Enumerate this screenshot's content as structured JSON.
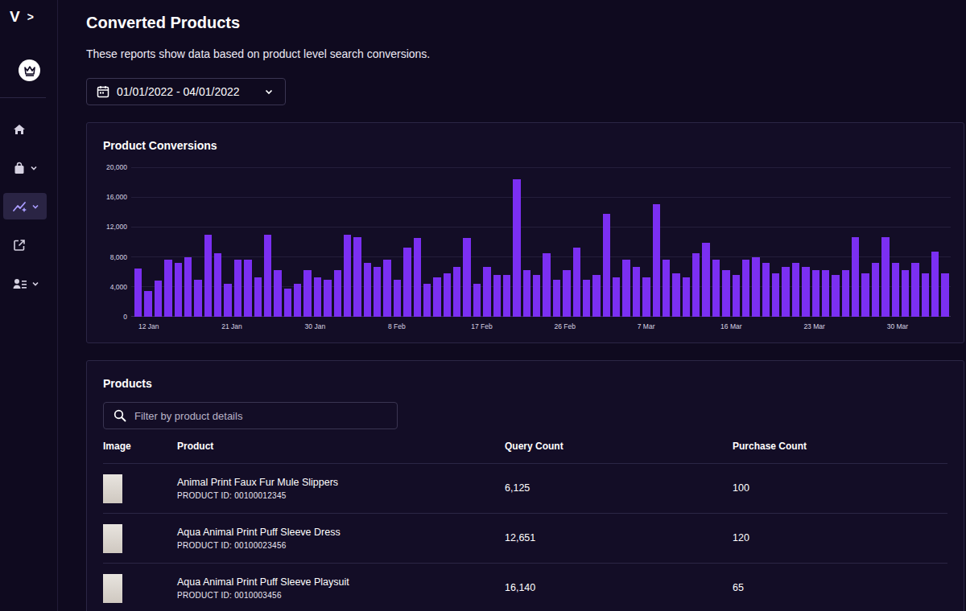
{
  "sidebar": {
    "brand": "V",
    "toggle": ">",
    "items": [
      {
        "expandable": false,
        "selected": false
      },
      {
        "expandable": true,
        "selected": false
      },
      {
        "expandable": true,
        "selected": true
      },
      {
        "expandable": false,
        "selected": false
      },
      {
        "expandable": true,
        "selected": false
      }
    ]
  },
  "page": {
    "title": "Converted Products",
    "subtitle": "These reports show data based on product level search conversions."
  },
  "date_range": {
    "label": "01/01/2022 - 04/01/2022"
  },
  "chart": {
    "title": "Product Conversions",
    "y_ticks": [
      "20,000",
      "16,000",
      "12,000",
      "8,000",
      "4,000",
      "0"
    ],
    "x_ticks": [
      "12 Jan",
      "21 Jan",
      "30 Jan",
      "8 Feb",
      "17 Feb",
      "26 Feb",
      "7 Mar",
      "16 Mar",
      "23 Mar",
      "30 Mar"
    ],
    "values": [
      6500,
      3400,
      4800,
      7600,
      7200,
      8000,
      4900,
      11000,
      8500,
      4400,
      7600,
      7600,
      5300,
      11000,
      6200,
      3800,
      4400,
      6200,
      5300,
      4900,
      6200,
      11000,
      10600,
      7200,
      6700,
      7600,
      4900,
      9200,
      10500,
      4400,
      5300,
      5800,
      6700,
      10500,
      4400,
      6700,
      5600,
      5600,
      18400,
      6200,
      5600,
      8500,
      4900,
      6200,
      9200,
      4900,
      5600,
      13800,
      5300,
      7600,
      6700,
      5300,
      15100,
      7600,
      5800,
      5300,
      8500,
      9900,
      7600,
      6200,
      5600,
      7600,
      8000,
      7200,
      5800,
      6700,
      7200,
      6700,
      6200,
      6200,
      5600,
      6200,
      10600,
      5800,
      7200,
      10600,
      7200,
      6200,
      7200,
      5800,
      8700,
      5800
    ]
  },
  "products": {
    "title": "Products",
    "search": {
      "placeholder": "Filter by product details"
    },
    "columns": [
      "Image",
      "Product",
      "Query Count",
      "Purchase Count"
    ],
    "rows": [
      {
        "name": "Animal Print Faux Fur Mule Slippers",
        "product_id": "PRODUCT ID: 00100012345",
        "query_count": "6,125",
        "purchase_count": "100"
      },
      {
        "name": "Aqua Animal Print Puff Sleeve Dress",
        "product_id": "PRODUCT ID: 00100023456",
        "query_count": "12,651",
        "purchase_count": "120"
      },
      {
        "name": "Aqua Animal Print Puff Sleeve Playsuit",
        "product_id": "PRODUCT ID: 0010003456",
        "query_count": "16,140",
        "purchase_count": "65"
      }
    ]
  }
}
